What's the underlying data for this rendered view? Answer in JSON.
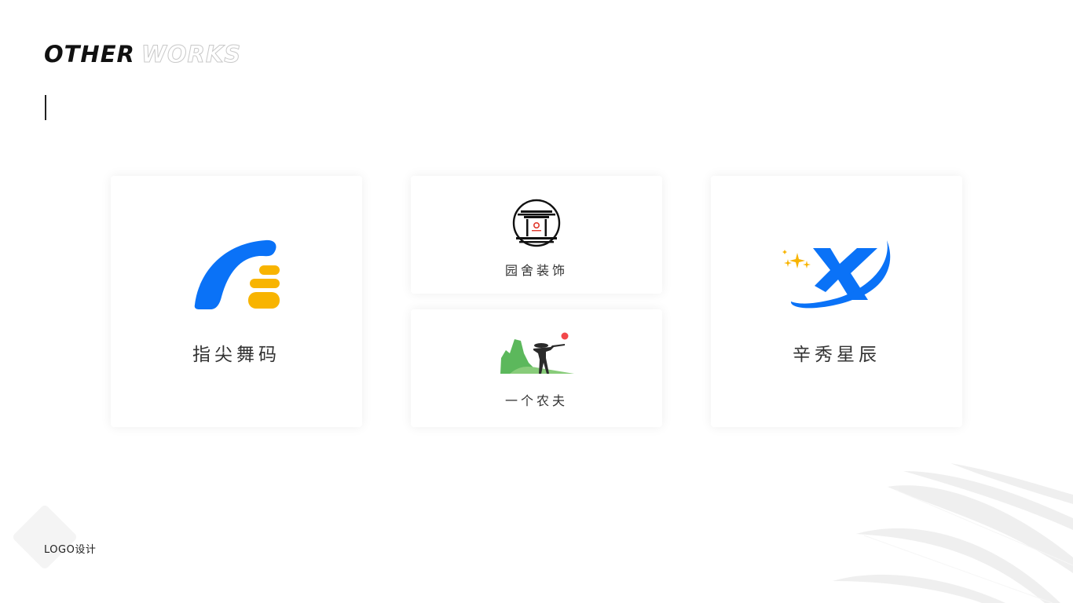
{
  "header": {
    "title_solid": "OTHER",
    "title_outline": "WORKS"
  },
  "cards": [
    {
      "label": "指尖舞码",
      "icon": "fingertip-dance-code-logo"
    },
    {
      "label": "园舍装饰",
      "icon": "yuanshe-decoration-logo"
    },
    {
      "label": "一个农夫",
      "icon": "farmer-logo"
    },
    {
      "label": "辛秀星辰",
      "icon": "xinxiu-stars-logo"
    }
  ],
  "footer": {
    "label": "LOGO设计"
  },
  "colors": {
    "blue": "#0a72f7",
    "yellow": "#f8b400",
    "green": "#5cb85c",
    "red_dot": "#f2474a",
    "text": "#333333"
  }
}
